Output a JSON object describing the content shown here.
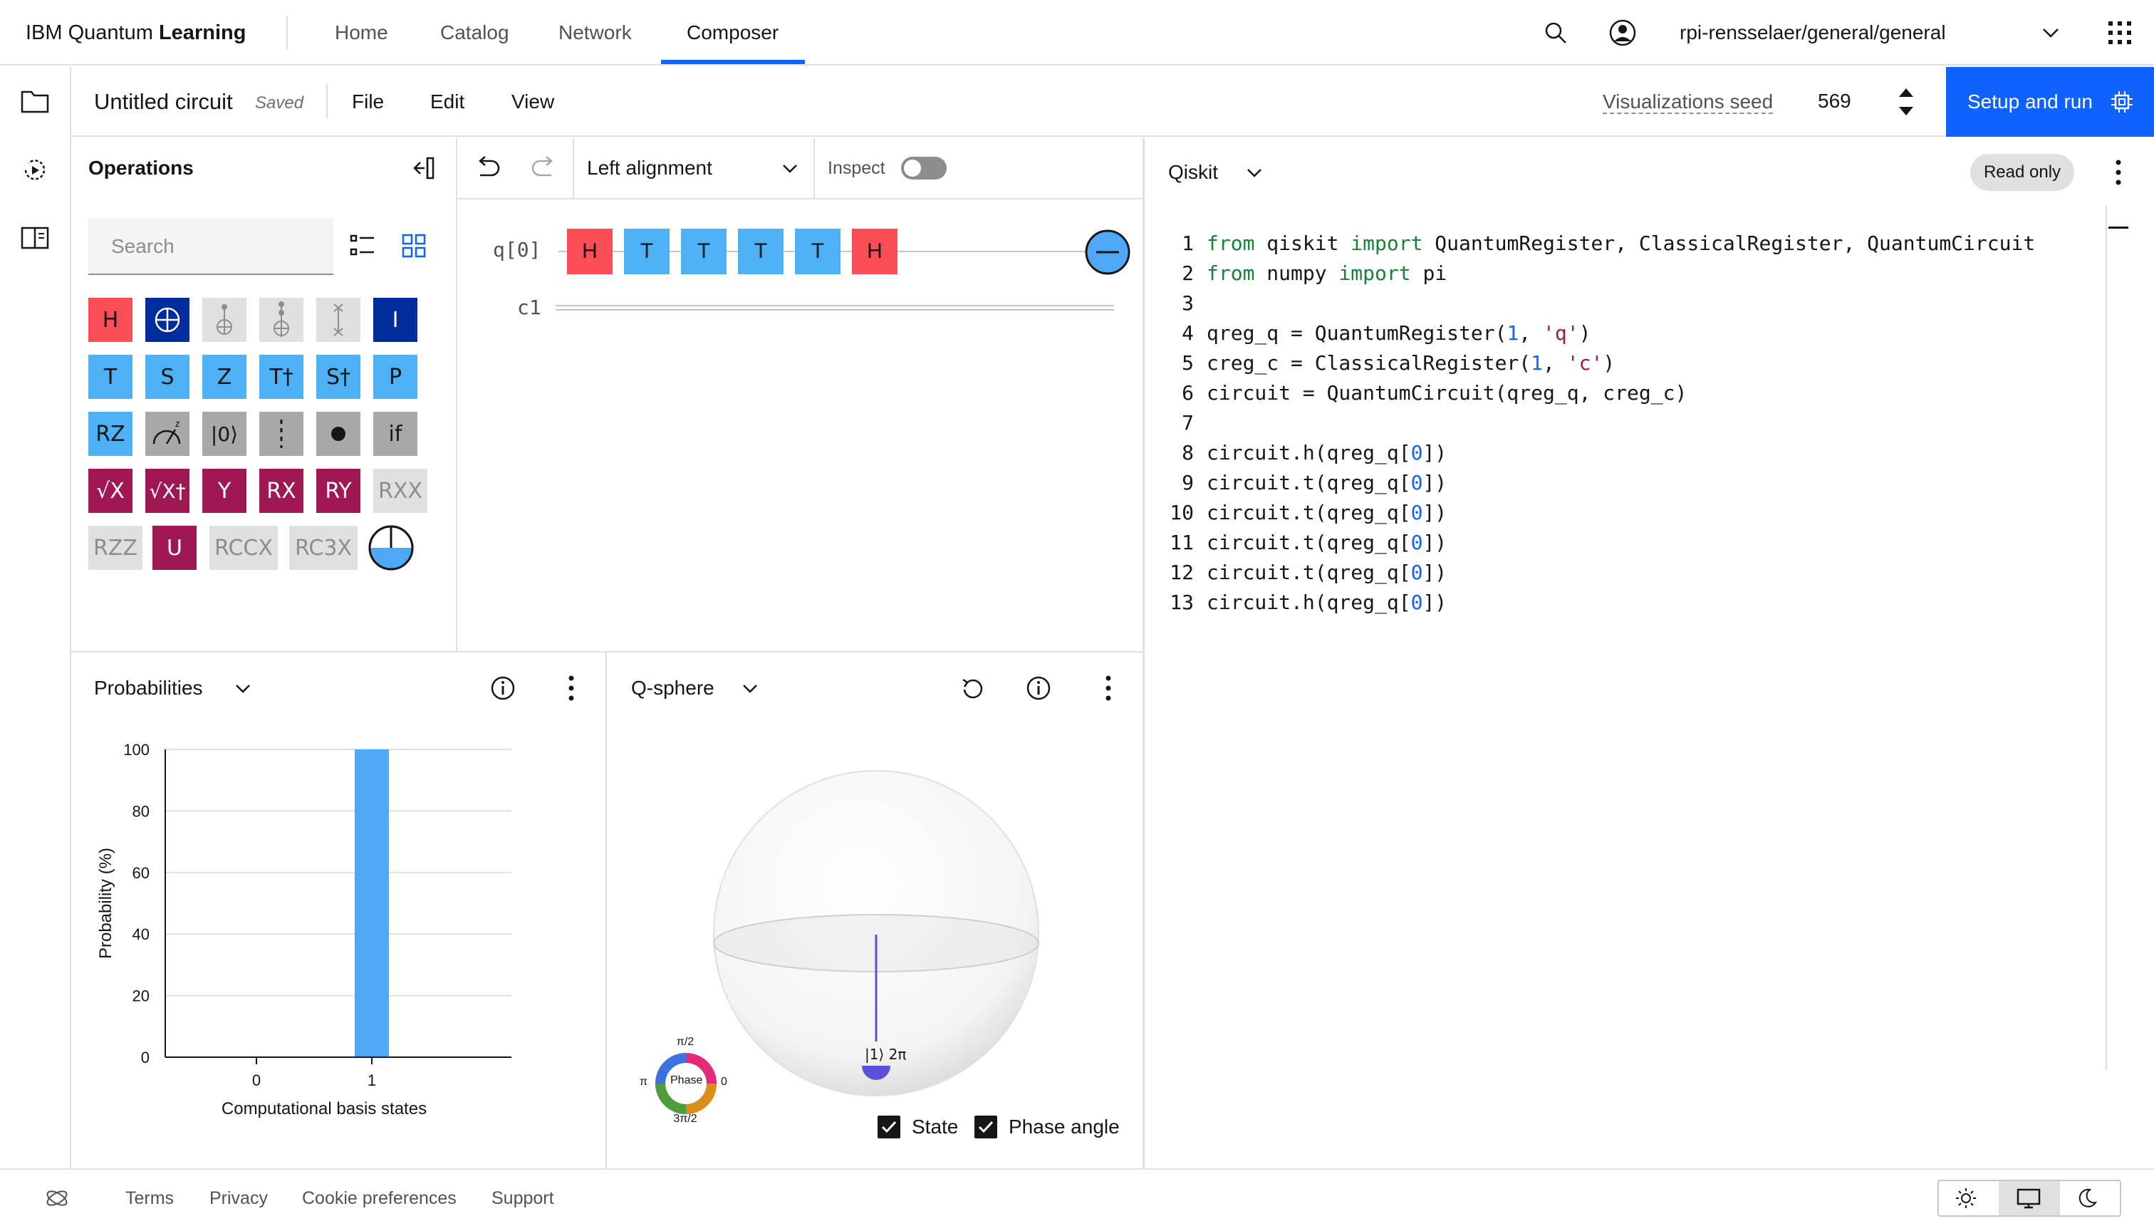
{
  "nav": {
    "brand_light": "IBM Quantum ",
    "brand_bold": "Learning",
    "links": [
      "Home",
      "Catalog",
      "Network",
      "Composer"
    ],
    "account": "rpi-rensselaer/general/general"
  },
  "toolbar": {
    "title": "Untitled circuit",
    "saved": "Saved",
    "menus": [
      "File",
      "Edit",
      "View"
    ],
    "seed_label": "Visualizations seed",
    "seed_value": "569",
    "run_label": "Setup and run"
  },
  "operations": {
    "title": "Operations",
    "search_placeholder": "Search",
    "rows": [
      [
        "H",
        "",
        "",
        "",
        "",
        "I"
      ],
      [
        "T",
        "S",
        "Z",
        "T†",
        "S†",
        "P"
      ],
      [
        "RZ",
        "",
        "|0⟩",
        "",
        "",
        "if"
      ],
      [
        "√X",
        "√X†",
        "Y",
        "RX",
        "RY",
        "RXX"
      ],
      [
        "RZZ",
        "U",
        "RCCX",
        "RC3X",
        ""
      ]
    ]
  },
  "circuit_toolbar": {
    "alignment": "Left alignment",
    "inspect": "Inspect"
  },
  "circuit": {
    "qubit": "q[0]",
    "classical": "c1",
    "gates": [
      "H",
      "T",
      "T",
      "T",
      "T",
      "H"
    ]
  },
  "code": {
    "language": "Qiskit",
    "badge": "Read only",
    "line_numbers": [
      "1",
      "2",
      "3",
      "4",
      "5",
      "6",
      "7",
      "8",
      "9",
      "10",
      "11",
      "12",
      "13"
    ]
  },
  "probabilities": {
    "title": "Probabilities",
    "chart_data": {
      "type": "bar",
      "categories": [
        "0",
        "1"
      ],
      "values": [
        0,
        100
      ],
      "xlabel": "Computational basis states",
      "ylabel": "Probability (%)",
      "ylim": [
        0,
        100
      ],
      "yticks": [
        "100",
        "80",
        "60",
        "40",
        "20",
        "0"
      ],
      "color": "#4fa8f5"
    }
  },
  "qsphere": {
    "title": "Q-sphere",
    "state_label": "|1⟩ 2π",
    "phase_label": "Phase",
    "phase_top": "π/2",
    "phase_left": "π",
    "phase_right": "0",
    "phase_bottom": "3π/2",
    "check_state": "State",
    "check_phase": "Phase angle"
  },
  "footer": {
    "links": [
      "Terms",
      "Privacy",
      "Cookie preferences",
      "Support"
    ]
  }
}
